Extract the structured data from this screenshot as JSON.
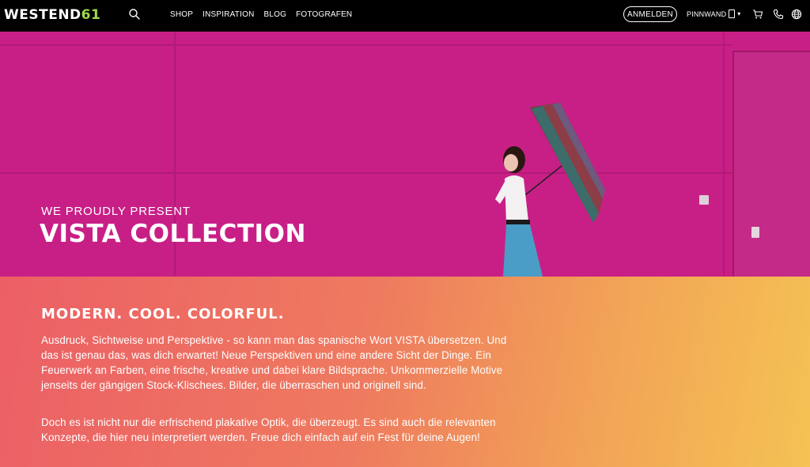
{
  "header": {
    "logo_main": "WESTEND",
    "logo_accent": "61",
    "nav": [
      "SHOP",
      "INSPIRATION",
      "BLOG",
      "FOTOGRAFEN"
    ],
    "login_label": "ANMELDEN",
    "pinnwand_label": "PINNWAND",
    "icons": [
      "search-icon",
      "cart-icon",
      "phone-icon",
      "globe-icon"
    ]
  },
  "hero": {
    "subtitle": "WE PROUDLY PRESENT",
    "title": "VISTA COLLECTION"
  },
  "content": {
    "heading": "MODERN. COOL. COLORFUL.",
    "paragraph1": "Ausdruck, Sichtweise und Perspektive - so kann man das spanische Wort VISTA übersetzen. Und das ist genau das, was dich erwartet! Neue Perspektiven und eine andere Sicht der Dinge. Ein Feuerwerk an Farben, eine frische, kreative und dabei klare Bildsprache. Unkommerzielle Motive jenseits der gängigen Stock-Klischees. Bilder, die überraschen und originell sind.",
    "paragraph2": "Doch es ist nicht nur die erfrischend plakative Optik, die überzeugt. Es sind auch die relevanten Konzepte, die hier neu interpretiert werden. Freue dich einfach auf ein Fest für deine Augen!"
  },
  "colors": {
    "hero_bg": "#c81f86",
    "logo_accent": "#9ed94a",
    "gradient_start": "#ec5f66",
    "gradient_end": "#f5c253"
  }
}
